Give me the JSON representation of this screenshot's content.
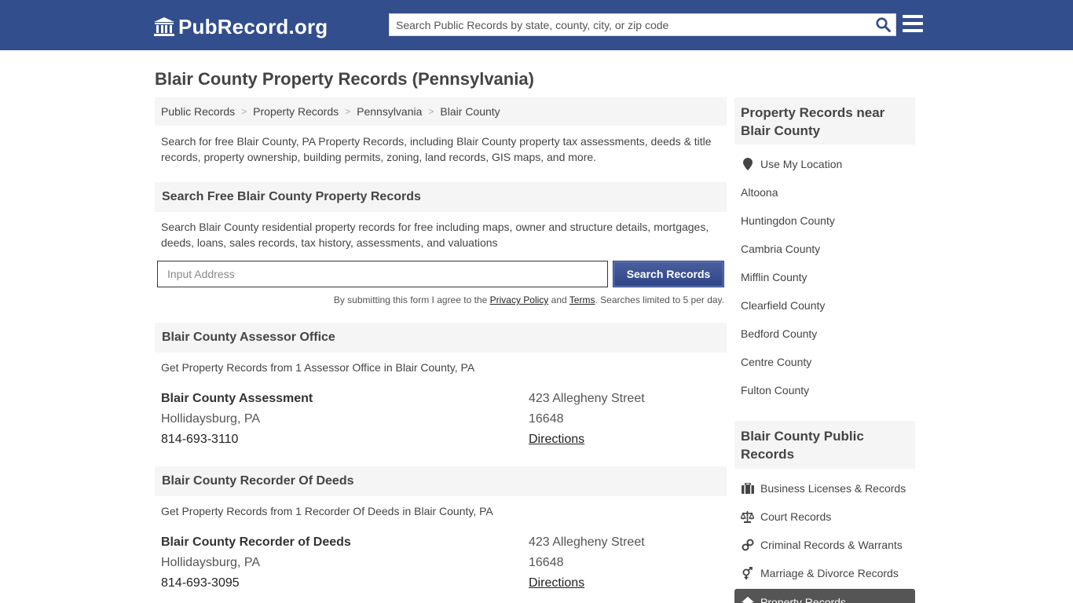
{
  "header": {
    "logo_text": "PubRecord.org",
    "search_placeholder": "Search Public Records by state, county, city, or zip code"
  },
  "page_title": "Blair County Property Records (Pennsylvania)",
  "breadcrumb": [
    "Public Records",
    "Property Records",
    "Pennsylvania",
    "Blair County"
  ],
  "intro": "Search for free Blair County, PA Property Records, including Blair County property tax assessments, deeds & title records, property ownership, building permits, zoning, land records, GIS maps, and more.",
  "search_section": {
    "heading": "Search Free Blair County Property Records",
    "description": "Search Blair County residential property records for free including maps, owner and structure details, mortgages, deeds, loans, sales records, tax history, assessments, and valuations",
    "input_placeholder": "Input Address",
    "button_label": "Search Records",
    "disclaimer_prefix": "By submitting this form I agree to the",
    "privacy_label": "Privacy Policy",
    "and_label": "and",
    "terms_label": "Terms",
    "disclaimer_suffix": ". Searches limited to 5 per day."
  },
  "assessor": {
    "heading": "Blair County Assessor Office",
    "description": "Get Property Records from 1 Assessor Office in Blair County, PA",
    "name": "Blair County Assessment",
    "city": "Hollidaysburg, PA",
    "phone": "814-693-3110",
    "street": "423 Allegheny Street",
    "zip": "16648",
    "directions": "Directions"
  },
  "recorder": {
    "heading": "Blair County Recorder Of Deeds",
    "description": "Get Property Records from 1 Recorder Of Deeds in Blair County, PA",
    "name": "Blair County Recorder of Deeds",
    "city": "Hollidaysburg, PA",
    "phone": "814-693-3095",
    "street": "423 Allegheny Street",
    "zip": "16648",
    "directions": "Directions"
  },
  "sidebar": {
    "near_heading": "Property Records near Blair County",
    "use_location": "Use My Location",
    "near_items": [
      "Altoona",
      "Huntingdon County",
      "Cambria County",
      "Mifflin County",
      "Clearfield County",
      "Bedford County",
      "Centre County",
      "Fulton County"
    ],
    "public_heading": "Blair County Public Records",
    "public_items": [
      {
        "label": "Business Licenses & Records",
        "icon": "briefcase-icon"
      },
      {
        "label": "Court Records",
        "icon": "scales-icon"
      },
      {
        "label": "Criminal Records & Warrants",
        "icon": "handcuffs-icon"
      },
      {
        "label": "Marriage & Divorce Records",
        "icon": "gender-icon"
      }
    ],
    "active_item": {
      "label": "Property Records",
      "icon": "home-icon"
    }
  },
  "colors": {
    "header_bg": "#334e8c",
    "button_bg": "#3a4f90",
    "panel_bg": "#f5f5f5"
  }
}
